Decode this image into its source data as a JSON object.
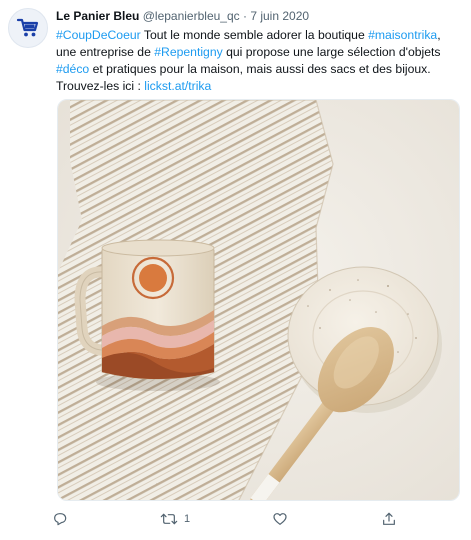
{
  "tweet": {
    "author_name": "Le Panier Bleu",
    "handle": "@lepanierbleu_qc",
    "separator": "·",
    "date": "7 juin 2020",
    "text": {
      "hashtag_coupdecoeur": "#CoupDeCoeur",
      "t1": " Tout le monde semble adorer la boutique ",
      "hashtag_maisontrika": "#maisontrika",
      "t2": ", une entreprise de ",
      "hashtag_repentigny": "#Repentigny",
      "t3": " qui propose une large sélection d'objets ",
      "hashtag_deco": "#déco",
      "t4": " et pratiques pour la maison, mais aussi des sacs et des bijoux. Trouvez-les ici : ",
      "link": "lickst.at/trika"
    },
    "actions": {
      "retweet_count": "1"
    },
    "colors": {
      "link": "#1d9bf0",
      "brand_blue": "#1a3fa8"
    },
    "icons": [
      "reply-icon",
      "retweet-icon",
      "like-icon",
      "share-icon"
    ]
  }
}
